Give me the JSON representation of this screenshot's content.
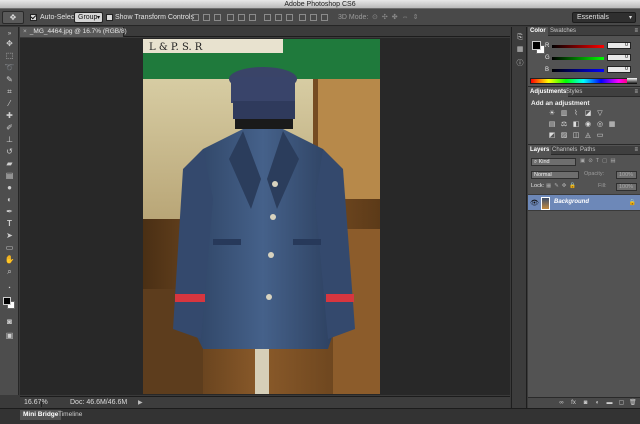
{
  "window": {
    "title": "Adobe Photoshop CS6"
  },
  "options_bar": {
    "auto_select_label": "Auto-Select:",
    "auto_select_value": "Group",
    "show_transform_label": "Show Transform Controls",
    "mode_3d_label": "3D Mode:",
    "workspace": "Essentials"
  },
  "document": {
    "tab_label": "_MG_4464.jpg @ 16.7% (RGB/8)"
  },
  "status_bar": {
    "zoom": "16.67%",
    "doc_size": "Doc: 46.6M/46.6M"
  },
  "bottom_tabs": [
    "Mini Bridge",
    "Timeline"
  ],
  "color_panel": {
    "tabs": [
      "Color",
      "Swatches"
    ],
    "channels": [
      {
        "label": "R",
        "value": "0",
        "gradient_color": "#ff0000"
      },
      {
        "label": "G",
        "value": "0",
        "gradient_color": "#00ff00"
      },
      {
        "label": "B",
        "value": "0",
        "gradient_color": "#0000ff"
      }
    ]
  },
  "adjustments_panel": {
    "tabs": [
      "Adjustments",
      "Styles"
    ],
    "title": "Add an adjustment"
  },
  "layers_panel": {
    "tabs": [
      "Layers",
      "Channels",
      "Paths"
    ],
    "filter_kind": "Kind",
    "blend_mode": "Normal",
    "opacity_label": "Opacity:",
    "opacity_value": "100%",
    "lock_label": "Lock:",
    "fill_label": "Fill:",
    "fill_value": "100%",
    "layer_name": "Background"
  },
  "photo_sign_text": "L & P. S. R"
}
